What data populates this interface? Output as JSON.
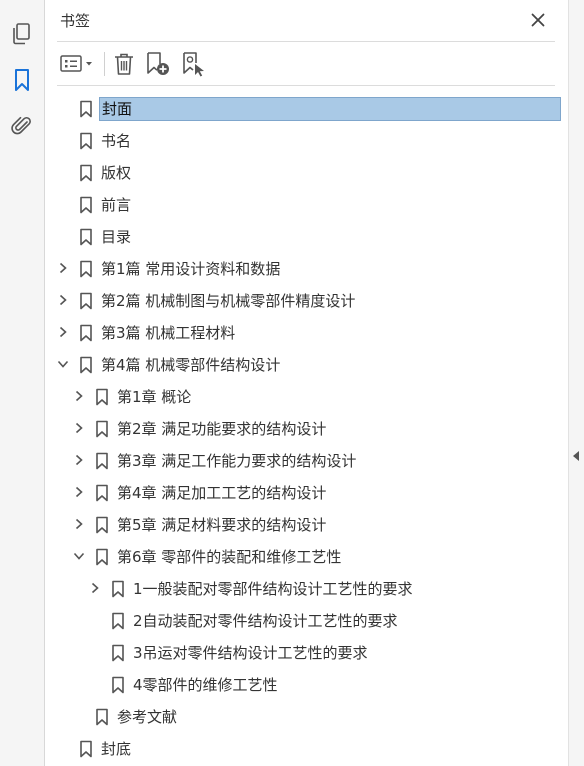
{
  "sidebar_tools": [
    {
      "name": "pages-icon"
    },
    {
      "name": "bookmark-icon"
    },
    {
      "name": "attachment-icon"
    }
  ],
  "panel": {
    "title": "书签"
  },
  "tree": [
    {
      "label": "封面",
      "level": 0,
      "expandable": false,
      "expanded": false,
      "selected": true
    },
    {
      "label": "书名",
      "level": 0,
      "expandable": false,
      "expanded": false
    },
    {
      "label": "版权",
      "level": 0,
      "expandable": false,
      "expanded": false
    },
    {
      "label": "前言",
      "level": 0,
      "expandable": false,
      "expanded": false
    },
    {
      "label": "目录",
      "level": 0,
      "expandable": false,
      "expanded": false
    },
    {
      "label": "第1篇  常用设计资料和数据",
      "level": 0,
      "expandable": true,
      "expanded": false
    },
    {
      "label": "第2篇  机械制图与机械零部件精度设计",
      "level": 0,
      "expandable": true,
      "expanded": false
    },
    {
      "label": "第3篇  机械工程材料",
      "level": 0,
      "expandable": true,
      "expanded": false
    },
    {
      "label": "第4篇  机械零部件结构设计",
      "level": 0,
      "expandable": true,
      "expanded": true
    },
    {
      "label": "第1章  概论",
      "level": 1,
      "expandable": true,
      "expanded": false
    },
    {
      "label": "第2章  满足功能要求的结构设计",
      "level": 1,
      "expandable": true,
      "expanded": false
    },
    {
      "label": "第3章  满足工作能力要求的结构设计",
      "level": 1,
      "expandable": true,
      "expanded": false
    },
    {
      "label": "第4章  满足加工工艺的结构设计",
      "level": 1,
      "expandable": true,
      "expanded": false
    },
    {
      "label": "第5章  满足材料要求的结构设计",
      "level": 1,
      "expandable": true,
      "expanded": false
    },
    {
      "label": "第6章  零部件的装配和维修工艺性",
      "level": 1,
      "expandable": true,
      "expanded": true
    },
    {
      "label": "1一般装配对零部件结构设计工艺性的要求",
      "level": 2,
      "expandable": true,
      "expanded": false
    },
    {
      "label": "2自动装配对零件结构设计工艺性的要求",
      "level": 2,
      "expandable": false,
      "expanded": false
    },
    {
      "label": "3吊运对零件结构设计工艺性的要求",
      "level": 2,
      "expandable": false,
      "expanded": false
    },
    {
      "label": "4零部件的维修工艺性",
      "level": 2,
      "expandable": false,
      "expanded": false
    },
    {
      "label": "参考文献",
      "level": 1,
      "expandable": false,
      "expanded": false
    },
    {
      "label": "封底",
      "level": 0,
      "expandable": false,
      "expanded": false
    }
  ]
}
